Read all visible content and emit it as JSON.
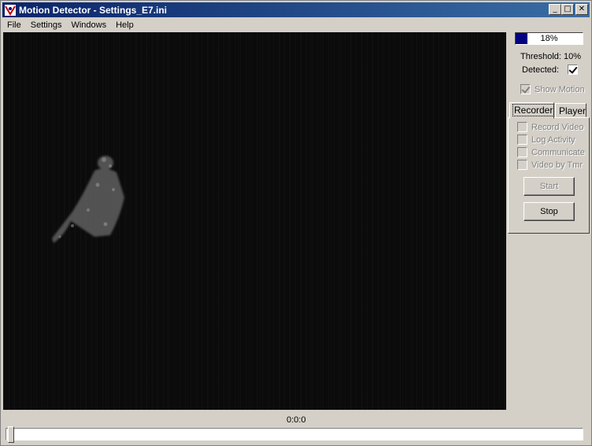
{
  "window": {
    "title": "Motion Detector - Settings_E7.ini",
    "minimize": "_",
    "maximize": "□",
    "close": "✕"
  },
  "menu": [
    "File",
    "Settings",
    "Windows",
    "Help"
  ],
  "level": {
    "percent_label": "18%",
    "value": 0.18,
    "fill_color": "#000080"
  },
  "threshold_label": "Threshold: 10%",
  "detected": {
    "label": "Detected:",
    "checked": true
  },
  "show_motion": {
    "label": "Show Motion",
    "checked": true,
    "enabled": false
  },
  "tabs": [
    {
      "label": "Recorder",
      "active": true
    },
    {
      "label": "Player",
      "active": false
    }
  ],
  "recorder": {
    "options": [
      {
        "label": "Record Video",
        "checked": false,
        "enabled": false
      },
      {
        "label": "Log Activity",
        "checked": false,
        "enabled": false
      },
      {
        "label": "Communicate",
        "checked": false,
        "enabled": false
      },
      {
        "label": "Video by Tmr",
        "checked": false,
        "enabled": false
      }
    ],
    "start_label": "Start",
    "stop_label": "Stop"
  },
  "playback": {
    "time": "0:0:0",
    "position": 0
  },
  "colors": {
    "titlebar_start": "#0a246a",
    "titlebar_end": "#3a6ea5",
    "video_bg": "#0b0b0b",
    "face": "#d4d0c8"
  },
  "icons": {
    "app": "motion-detector-app-icon"
  }
}
